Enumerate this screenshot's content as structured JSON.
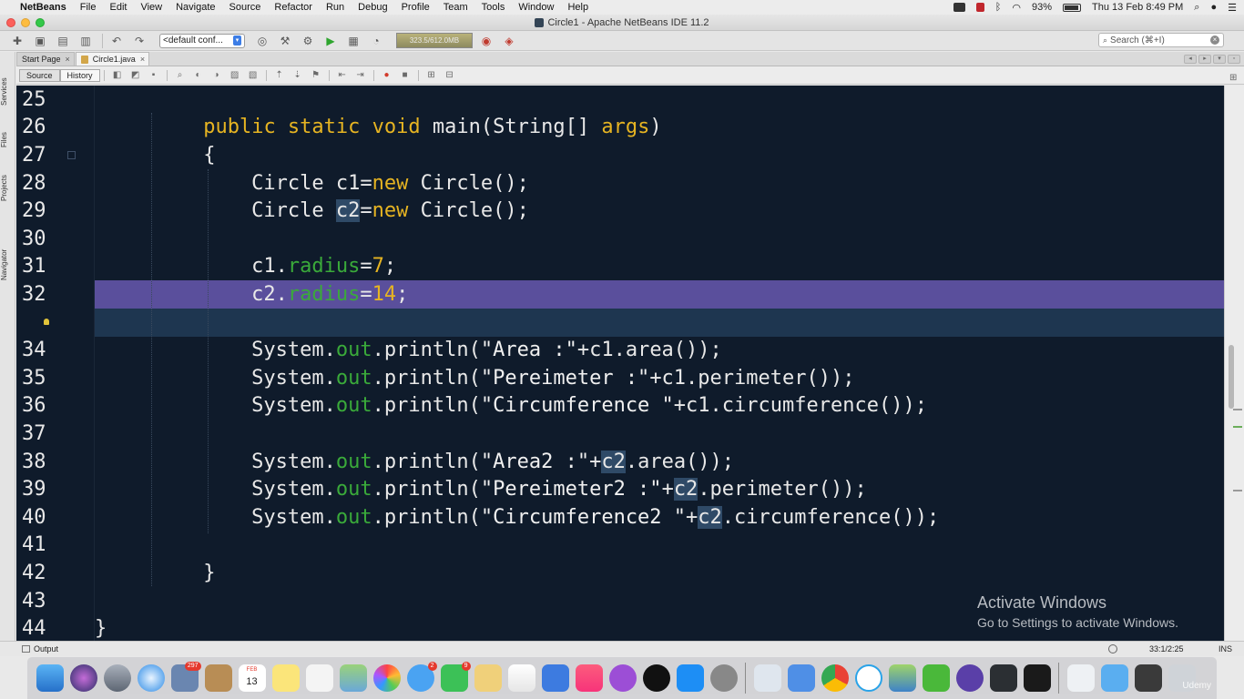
{
  "menubar": {
    "app_name": "NetBeans",
    "menus": [
      "File",
      "Edit",
      "View",
      "Navigate",
      "Source",
      "Refactor",
      "Run",
      "Debug",
      "Profile",
      "Team",
      "Tools",
      "Window",
      "Help"
    ],
    "battery": "93%",
    "datetime": "Thu 13 Feb  8:49 PM"
  },
  "window": {
    "title": "Circle1 - Apache NetBeans IDE 11.2"
  },
  "toolbar": {
    "config_value": "<default conf...",
    "memory": "323.5/612.0MB",
    "search_placeholder": "Search (⌘+I)"
  },
  "side_tabs": [
    "Services",
    "Files",
    "Projects",
    "Navigator"
  ],
  "editor_tabs": [
    {
      "label": "Start Page",
      "active": false
    },
    {
      "label": "Circle1.java",
      "active": true
    }
  ],
  "editor_toolbar": {
    "source_label": "Source",
    "history_label": "History"
  },
  "code": {
    "lines": [
      {
        "n": "25"
      },
      {
        "n": "26"
      },
      {
        "n": "27"
      },
      {
        "n": "28"
      },
      {
        "n": "29"
      },
      {
        "n": "30"
      },
      {
        "n": "31"
      },
      {
        "n": "32"
      },
      {
        "n": ""
      },
      {
        "n": "34"
      },
      {
        "n": "35"
      },
      {
        "n": "36"
      },
      {
        "n": "37"
      },
      {
        "n": "38"
      },
      {
        "n": "39"
      },
      {
        "n": "40"
      },
      {
        "n": "41"
      },
      {
        "n": "42"
      },
      {
        "n": "43"
      },
      {
        "n": "44"
      }
    ],
    "highlight_color": "#5a4f9c",
    "current_line_color": "#1e3650"
  },
  "watermark": {
    "title": "Activate Windows",
    "subtitle": "Go to Settings to activate Windows."
  },
  "statusbar": {
    "output_label": "Output",
    "caret_position": "33:1/2:25",
    "mode": "INS"
  },
  "dock": {
    "calendar_day": "13",
    "calendar_month": "FEB",
    "badges": {
      "contacts": "297",
      "messages": "2",
      "facetime": "9"
    },
    "brand": "Udemy"
  }
}
